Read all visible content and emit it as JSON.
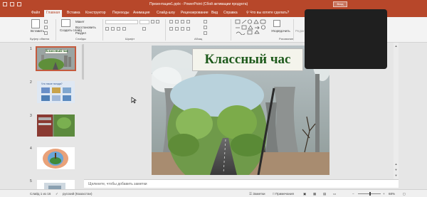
{
  "window": {
    "title": "Презентация1.pptx  -  PowerPoint (Сбой активации продукта)",
    "signin_label": "Вход"
  },
  "tabs": [
    {
      "label": "Файл"
    },
    {
      "label": "Главная"
    },
    {
      "label": "Вставка"
    },
    {
      "label": "Конструктор"
    },
    {
      "label": "Переходы"
    },
    {
      "label": "Анимация"
    },
    {
      "label": "Слайд-шоу"
    },
    {
      "label": "Рецензирование"
    },
    {
      "label": "Вид"
    },
    {
      "label": "Справка"
    },
    {
      "label": "Что вы хотите сделать?"
    }
  ],
  "ribbon": {
    "clipboard": {
      "paste": "Вставить",
      "group": "Буфер обмена"
    },
    "slides": {
      "new_slide": "Создать слайд",
      "layout": "Макет",
      "reset": "Восстановить",
      "section": "Раздел",
      "group": "Слайды"
    },
    "font": {
      "group": "Шрифт"
    },
    "paragraph": {
      "group": "Абзац"
    },
    "drawing": {
      "arrange": "Упорядочить",
      "group": "Рисование"
    },
    "editing": {
      "group": "Редактир"
    }
  },
  "thumbnails": [
    {
      "num": "1",
      "caption": "Классный час"
    },
    {
      "num": "2",
      "caption": "Что такое погода?"
    },
    {
      "num": "3",
      "caption": ""
    },
    {
      "num": "4",
      "caption": ""
    },
    {
      "num": "5",
      "caption": ""
    }
  ],
  "slide": {
    "title": "Классный час"
  },
  "notes": {
    "placeholder": "Щелкните, чтобы добавить заметки"
  },
  "status": {
    "slide_of": "Слайд 1 из 16",
    "language": "русский (Казахстан)",
    "notes": "Заметки",
    "comments": "Примечания",
    "zoom": "68%"
  },
  "colors": {
    "accent": "#b7472a",
    "title_text": "#1e5a1c"
  }
}
